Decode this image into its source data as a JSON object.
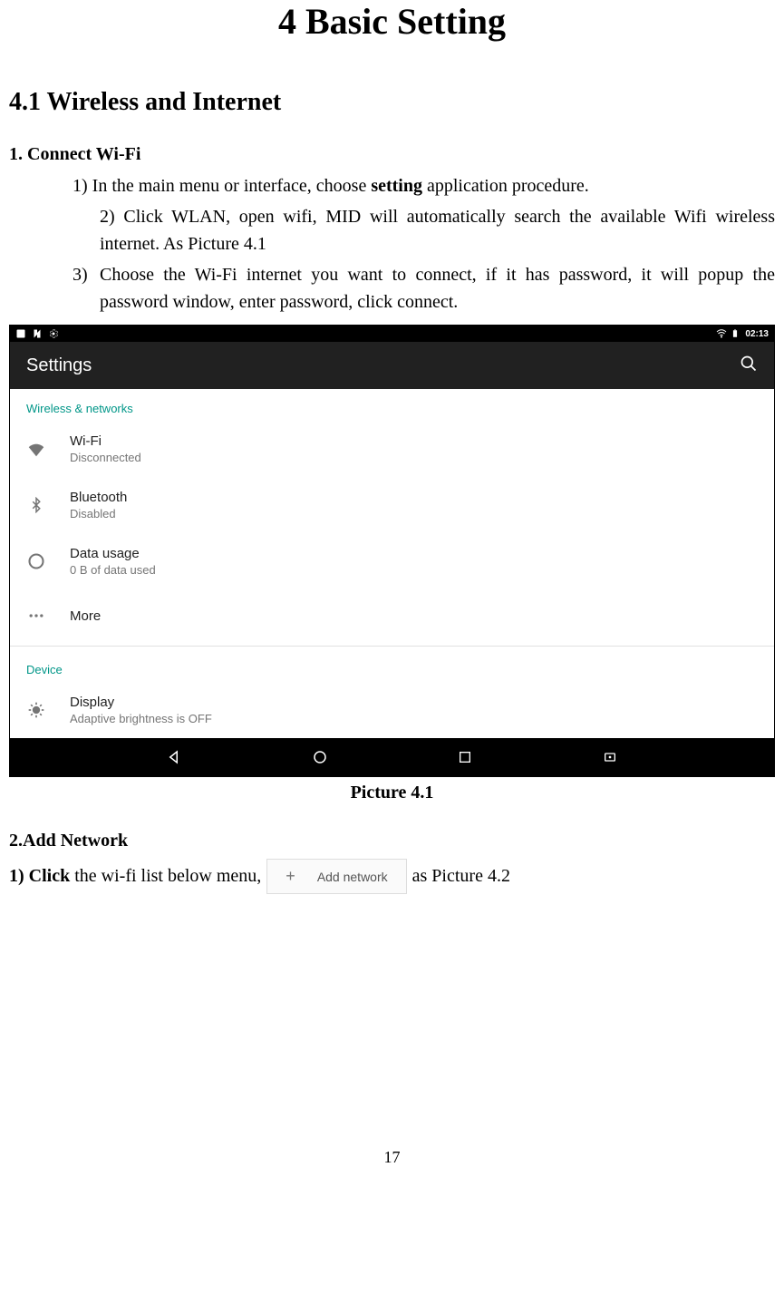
{
  "chapter": "4 Basic Setting",
  "section": "4.1 Wireless and Internet",
  "sub1_title": "1. Connect Wi-Fi",
  "step1_pre": "1) In the main menu or interface, choose ",
  "step1_bold": "setting",
  "step1_post": " application procedure.",
  "step2": "2) Click WLAN, open wifi, MID will automatically search the available Wifi wireless internet. As Picture 4.1",
  "step3_num": "3)",
  "step3_txt": "Choose the Wi-Fi internet you want to connect, if it has password, it will popup the password window, enter password, click connect.",
  "caption1": "Picture 4.1",
  "sub2_title": "2.Add Network",
  "addnet_pre_bold": "1) Click",
  "addnet_pre_rest": " the wi-fi list below menu, ",
  "addnet_chip": "Add network",
  "addnet_post": "  as Picture 4.2",
  "page_number": "17",
  "screenshot": {
    "time": "02:13",
    "appbar_title": "Settings",
    "section_wireless": "Wireless & networks",
    "section_device": "Device",
    "items": {
      "wifi": {
        "title": "Wi-Fi",
        "sub": "Disconnected"
      },
      "bluetooth": {
        "title": "Bluetooth",
        "sub": "Disabled"
      },
      "data": {
        "title": "Data usage",
        "sub": "0 B of data used"
      },
      "more": {
        "title": "More"
      },
      "display": {
        "title": "Display",
        "sub": "Adaptive brightness is OFF"
      }
    }
  }
}
